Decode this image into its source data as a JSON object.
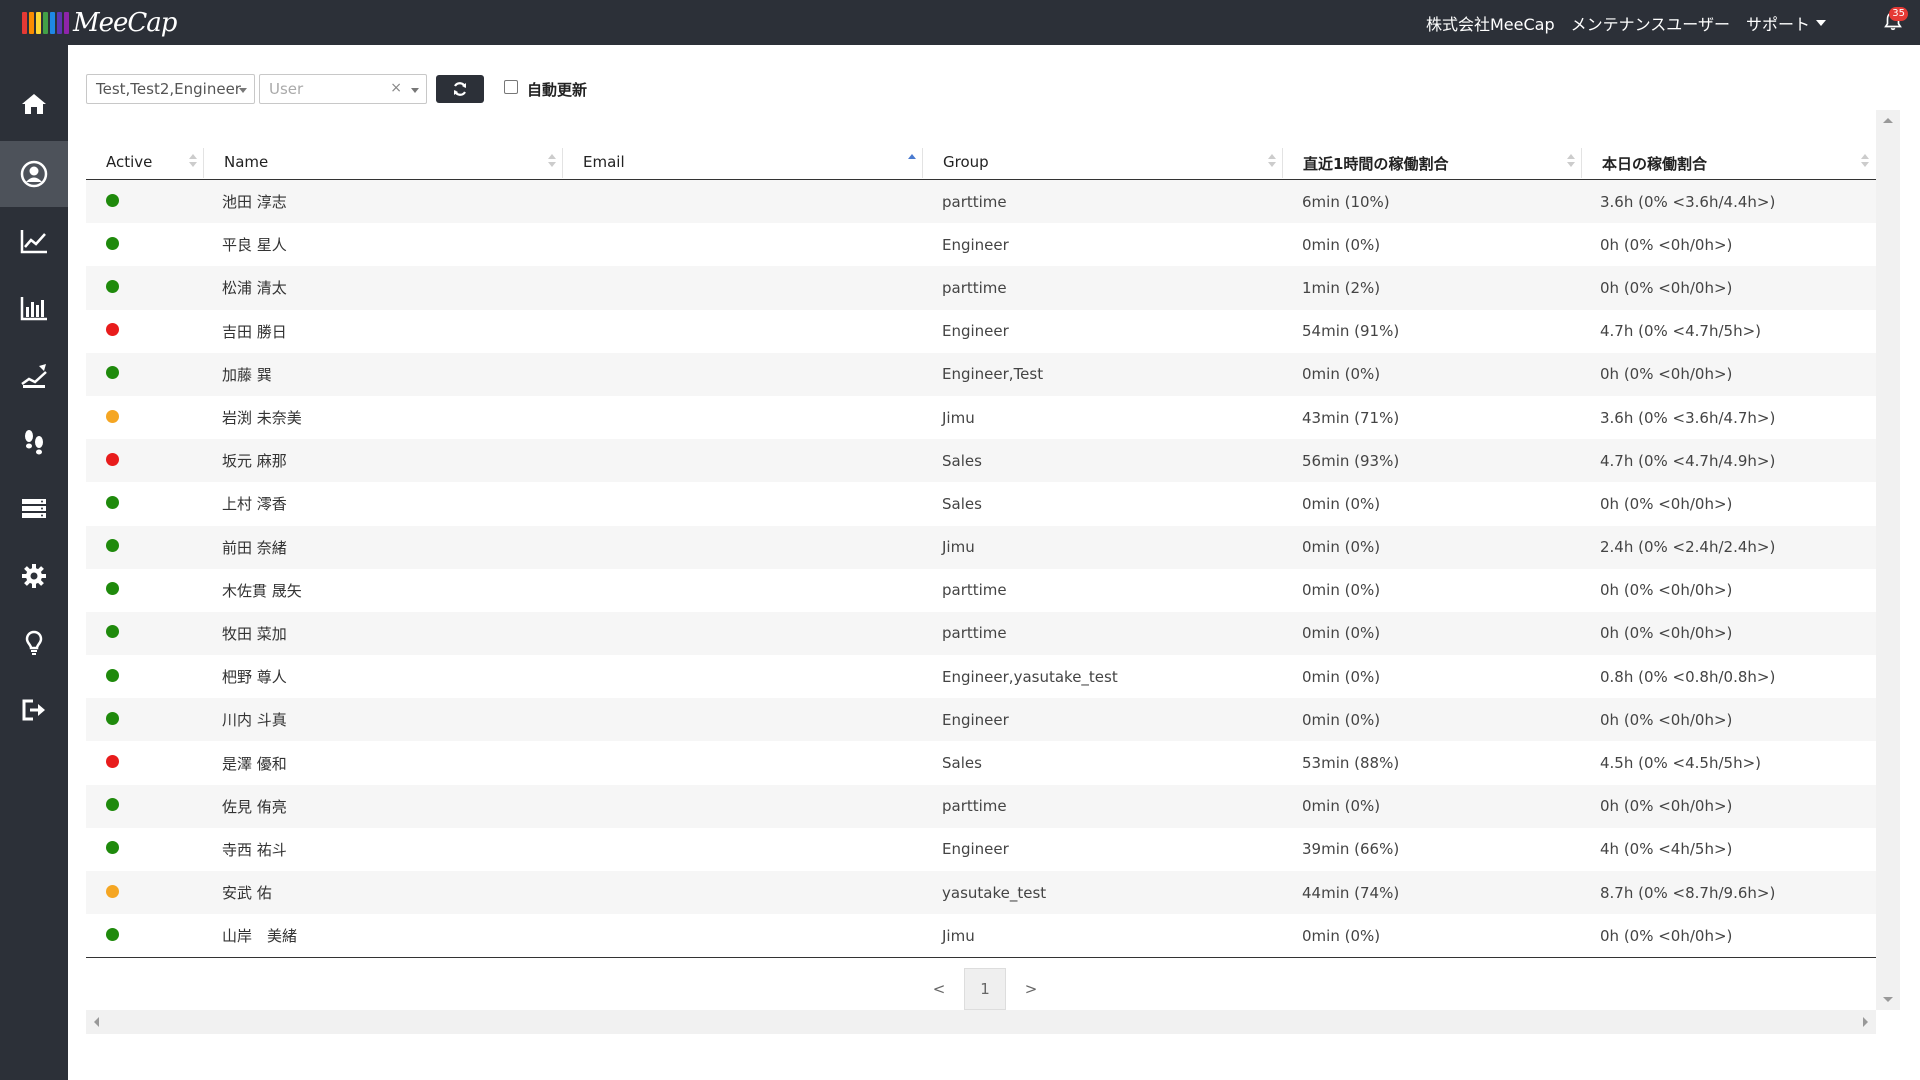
{
  "header": {
    "logo_text": "MeeCap",
    "logo_colors": [
      "#e53935",
      "#fb8c00",
      "#fdd835",
      "#43a047",
      "#1e88e5",
      "#5e35b1",
      "#8e24aa"
    ],
    "company": "株式会社MeeCap",
    "user": "メンテナンスユーザー",
    "support": "サポート",
    "notification_count": "35"
  },
  "sidebar": {
    "items": [
      {
        "icon": "home-icon"
      },
      {
        "icon": "user-circle-icon",
        "active": true
      },
      {
        "icon": "line-chart-icon"
      },
      {
        "icon": "bar-chart-icon"
      },
      {
        "icon": "growth-icon"
      },
      {
        "icon": "footsteps-icon"
      },
      {
        "icon": "server-list-icon"
      },
      {
        "icon": "gear-icon"
      },
      {
        "icon": "lightbulb-icon"
      },
      {
        "icon": "logout-icon"
      }
    ]
  },
  "filters": {
    "group_value": "Test,Test2,Engineer",
    "user_placeholder": "User",
    "clear_symbol": "×",
    "auto_refresh_label": "自動更新"
  },
  "table": {
    "columns": [
      "Active",
      "Name",
      "Email",
      "Group",
      "直近1時間の稼働割合",
      "本日の稼働割合"
    ],
    "status_colors": {
      "green": "#1f8a0c",
      "red": "#e81c1c",
      "orange": "#f5a623"
    },
    "rows": [
      {
        "status": "green",
        "name": "池田 淳志",
        "email": "",
        "group": "parttime",
        "last_hour": "6min (10%)",
        "today": "3.6h (0% <3.6h/4.4h>)"
      },
      {
        "status": "green",
        "name": "平良 星人",
        "email": "",
        "group": "Engineer",
        "last_hour": "0min (0%)",
        "today": "0h (0% <0h/0h>)"
      },
      {
        "status": "green",
        "name": "松浦 清太",
        "email": "",
        "group": "parttime",
        "last_hour": "1min (2%)",
        "today": "0h (0% <0h/0h>)"
      },
      {
        "status": "red",
        "name": "吉田 勝日",
        "email": "",
        "group": "Engineer",
        "last_hour": "54min (91%)",
        "today": "4.7h (0% <4.7h/5h>)"
      },
      {
        "status": "green",
        "name": "加藤 巽",
        "email": "",
        "group": "Engineer,Test",
        "last_hour": "0min (0%)",
        "today": "0h (0% <0h/0h>)"
      },
      {
        "status": "orange",
        "name": "岩渕 未奈美",
        "email": "",
        "group": "Jimu",
        "last_hour": "43min (71%)",
        "today": "3.6h (0% <3.6h/4.7h>)"
      },
      {
        "status": "red",
        "name": "坂元 麻那",
        "email": "",
        "group": "Sales",
        "last_hour": "56min (93%)",
        "today": "4.7h (0% <4.7h/4.9h>)"
      },
      {
        "status": "green",
        "name": "上村 澪香",
        "email": "",
        "group": "Sales",
        "last_hour": "0min (0%)",
        "today": "0h (0% <0h/0h>)"
      },
      {
        "status": "green",
        "name": "前田 奈緒",
        "email": "",
        "group": "Jimu",
        "last_hour": "0min (0%)",
        "today": "2.4h (0% <2.4h/2.4h>)"
      },
      {
        "status": "green",
        "name": "木佐貫 晟矢",
        "email": "",
        "group": "parttime",
        "last_hour": "0min (0%)",
        "today": "0h (0% <0h/0h>)"
      },
      {
        "status": "green",
        "name": "牧田 菜加",
        "email": "",
        "group": "parttime",
        "last_hour": "0min (0%)",
        "today": "0h (0% <0h/0h>)"
      },
      {
        "status": "green",
        "name": "杷野 尊人",
        "email": "",
        "group": "Engineer,yasutake_test",
        "last_hour": "0min (0%)",
        "today": "0.8h (0% <0.8h/0.8h>)"
      },
      {
        "status": "green",
        "name": "川内 斗真",
        "email": "",
        "group": "Engineer",
        "last_hour": "0min (0%)",
        "today": "0h (0% <0h/0h>)"
      },
      {
        "status": "red",
        "name": "是澤 優和",
        "email": "",
        "group": "Sales",
        "last_hour": "53min (88%)",
        "today": "4.5h (0% <4.5h/5h>)"
      },
      {
        "status": "green",
        "name": "佐見 侑亮",
        "email": "",
        "group": "parttime",
        "last_hour": "0min (0%)",
        "today": "0h (0% <0h/0h>)"
      },
      {
        "status": "green",
        "name": "寺西 祐斗",
        "email": "",
        "group": "Engineer",
        "last_hour": "39min (66%)",
        "today": "4h (0% <4h/5h>)"
      },
      {
        "status": "orange",
        "name": "安武 佑",
        "email": "",
        "group": "yasutake_test",
        "last_hour": "44min (74%)",
        "today": "8.7h (0% <8.7h/9.6h>)"
      },
      {
        "status": "green",
        "name": "山岸　美緒",
        "email": "",
        "group": "Jimu",
        "last_hour": "0min (0%)",
        "today": "0h (0% <0h/0h>)"
      }
    ]
  },
  "pagination": {
    "prev": "<",
    "current": "1",
    "next": ">"
  }
}
